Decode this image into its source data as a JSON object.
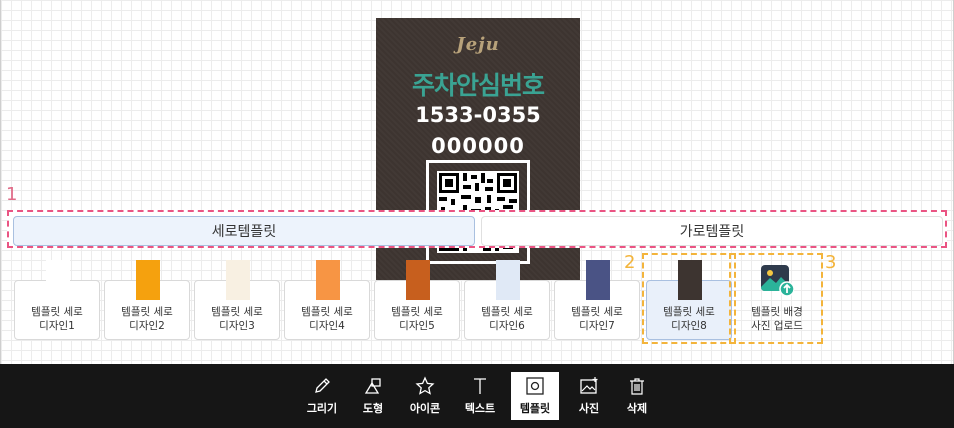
{
  "preview": {
    "logo": "Jeju",
    "title": "주차안심번호",
    "phone": "1533-0355",
    "number": "000000",
    "bg_color": "#3d3430"
  },
  "annotations": [
    "1",
    "2",
    "3"
  ],
  "tabs": [
    {
      "label": "세로템플릿",
      "active": true
    },
    {
      "label": "가로템플릿",
      "active": false
    }
  ],
  "templates": [
    {
      "label": "템플릿 세로\n디자인1",
      "color": "#ffffff"
    },
    {
      "label": "템플릿 세로\n디자인2",
      "color": "#f5a10e"
    },
    {
      "label": "템플릿 세로\n디자인3",
      "color": "#f8f0e2"
    },
    {
      "label": "템플릿 세로\n디자인4",
      "color": "#f79544"
    },
    {
      "label": "템플릿 세로\n디자인5",
      "color": "#c75f1e"
    },
    {
      "label": "템플릿 세로\n디자인6",
      "color": "#e0e9f6"
    },
    {
      "label": "템플릿 세로\n디자인7",
      "color": "#4a5385"
    },
    {
      "label": "템플릿 세로\n디자인8",
      "color": "#3d3430"
    }
  ],
  "upload": {
    "label": "템플릿 배경\n사진 업로드",
    "icon": "image-upload-icon"
  },
  "toolbar": [
    {
      "label": "그리기",
      "icon": "pencil-icon"
    },
    {
      "label": "도형",
      "icon": "shapes-icon"
    },
    {
      "label": "아이콘",
      "icon": "star-icon"
    },
    {
      "label": "텍스트",
      "icon": "text-icon"
    },
    {
      "label": "템플릿",
      "icon": "template-icon",
      "active": true
    },
    {
      "label": "사진",
      "icon": "photo-icon"
    },
    {
      "label": "삭제",
      "icon": "trash-icon"
    }
  ]
}
